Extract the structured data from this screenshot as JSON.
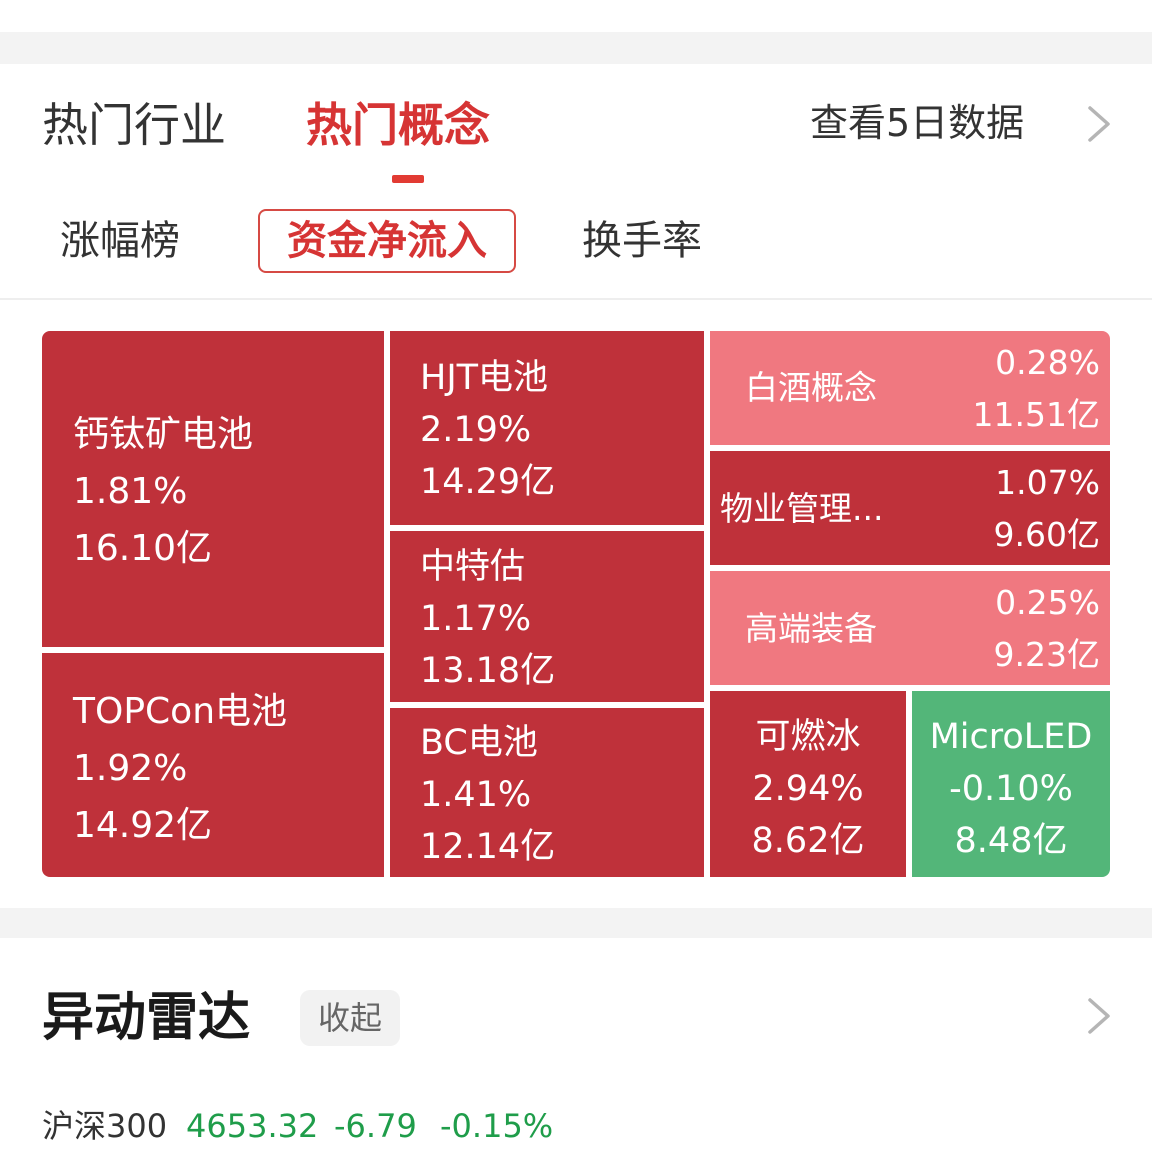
{
  "header": {
    "tabs": [
      {
        "label": "热门行业",
        "active": false
      },
      {
        "label": "热门概念",
        "active": true
      }
    ],
    "view_5day_label": "查看5日数据"
  },
  "sub_tabs": [
    {
      "label": "涨幅榜",
      "active": false
    },
    {
      "label": "资金净流入",
      "active": true
    },
    {
      "label": "换手率",
      "active": false
    }
  ],
  "colors": {
    "up_strong": "#bf313a",
    "up_light": "#f07880",
    "down": "#53b679",
    "accent": "#d63434"
  },
  "treemap": [
    {
      "name": "钙钛矿电池",
      "change": "1.81%",
      "inflow": "16.10亿"
    },
    {
      "name": "TOPCon电池",
      "change": "1.92%",
      "inflow": "14.92亿"
    },
    {
      "name": "HJT电池",
      "change": "2.19%",
      "inflow": "14.29亿"
    },
    {
      "name": "中特估",
      "change": "1.17%",
      "inflow": "13.18亿"
    },
    {
      "name": "BC电池",
      "change": "1.41%",
      "inflow": "12.14亿"
    },
    {
      "name": "白酒概念",
      "change": "0.28%",
      "inflow": "11.51亿"
    },
    {
      "name": "物业管理...",
      "change": "1.07%",
      "inflow": "9.60亿"
    },
    {
      "name": "高端装备",
      "change": "0.25%",
      "inflow": "9.23亿"
    },
    {
      "name": "可燃冰",
      "change": "2.94%",
      "inflow": "8.62亿"
    },
    {
      "name": "MicroLED",
      "change": "-0.10%",
      "inflow": "8.48亿"
    }
  ],
  "radar": {
    "title": "异动雷达",
    "collapse_label": "收起"
  },
  "index_quote": {
    "name": "沪深300",
    "price": "4653.32",
    "change": "-6.79",
    "change_pct": "-0.15%"
  }
}
